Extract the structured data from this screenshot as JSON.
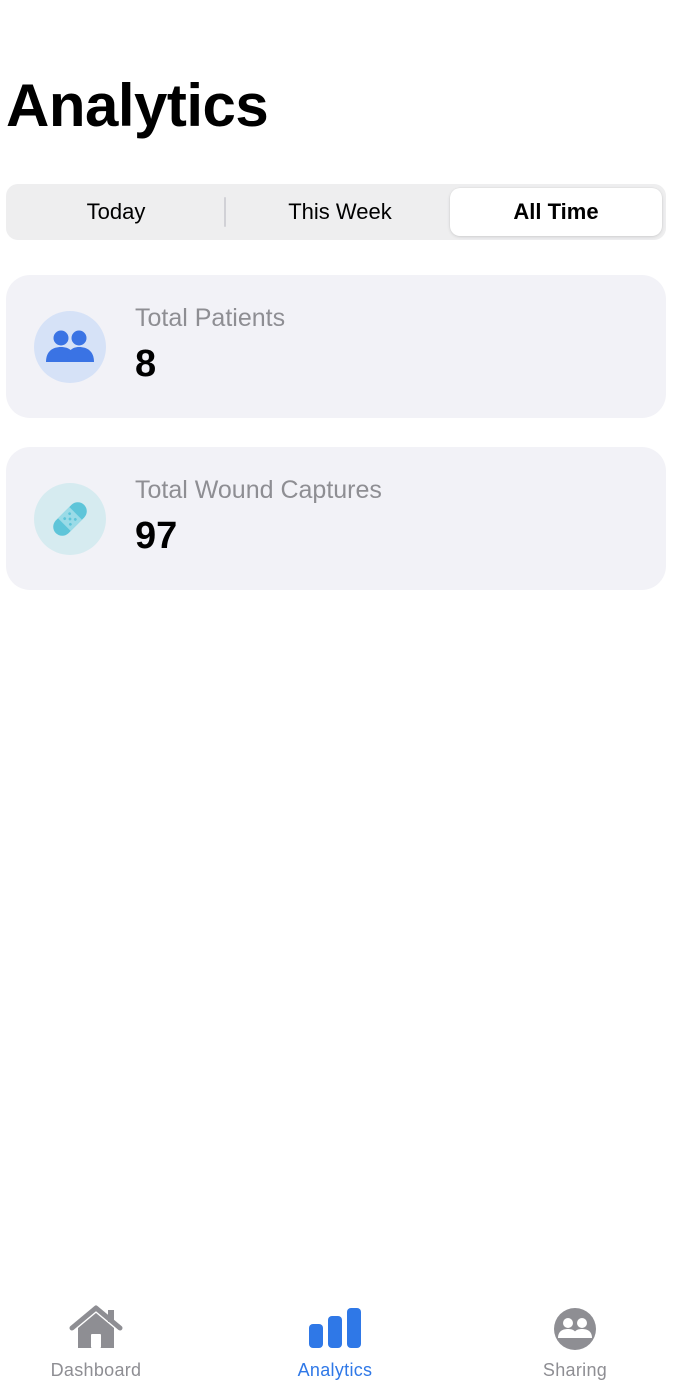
{
  "header": {
    "title": "Analytics"
  },
  "segments": {
    "items": [
      {
        "label": "Today"
      },
      {
        "label": "This Week"
      },
      {
        "label": "All Time"
      }
    ],
    "selected": "All Time"
  },
  "stats": [
    {
      "label": "Total Patients",
      "value": "8",
      "icon": "people-icon",
      "color": "#3a73e4"
    },
    {
      "label": "Total Wound Captures",
      "value": "97",
      "icon": "bandage-icon",
      "color": "#5ec5d9"
    }
  ],
  "tabbar": {
    "items": [
      {
        "label": "Dashboard",
        "icon": "house-icon"
      },
      {
        "label": "Analytics",
        "icon": "bar-chart-icon"
      },
      {
        "label": "Sharing",
        "icon": "people-circle-icon"
      }
    ],
    "active": "Analytics",
    "active_color": "#2f78e7",
    "inactive_color": "#8e8e93"
  }
}
